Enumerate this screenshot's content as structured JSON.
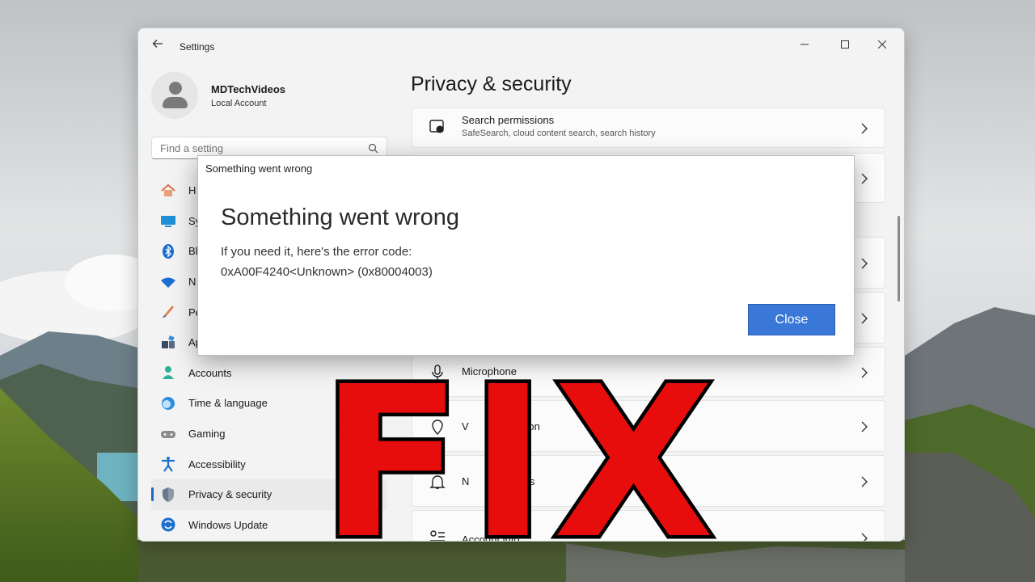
{
  "window": {
    "app_title": "Settings",
    "back_icon": "arrow-left-icon",
    "controls": {
      "minimize_icon": "minimize-icon",
      "maximize_icon": "maximize-icon",
      "close_icon": "close-icon"
    }
  },
  "profile": {
    "name": "MDTechVideos",
    "account_type": "Local Account"
  },
  "search": {
    "placeholder": "Find a setting"
  },
  "sidebar": {
    "items": [
      {
        "label": "H",
        "icon": "home-icon"
      },
      {
        "label": "Sy",
        "icon": "system-icon"
      },
      {
        "label": "Bl",
        "icon": "bluetooth-icon"
      },
      {
        "label": "N",
        "icon": "network-icon"
      },
      {
        "label": "Pe",
        "icon": "personalization-icon"
      },
      {
        "label": "Ap",
        "icon": "apps-icon"
      },
      {
        "label": "Accounts",
        "icon": "accounts-icon"
      },
      {
        "label": "Time & language",
        "icon": "time-language-icon"
      },
      {
        "label": "Gaming",
        "icon": "gaming-icon"
      },
      {
        "label": "Accessibility",
        "icon": "accessibility-icon"
      },
      {
        "label": "Privacy & security",
        "icon": "shield-icon",
        "active": true
      },
      {
        "label": "Windows Update",
        "icon": "windows-update-icon"
      }
    ]
  },
  "main": {
    "title": "Privacy & security",
    "cards": [
      {
        "title": "Search permissions",
        "subtitle": "SafeSearch, cloud content search, search history",
        "icon": "search-permissions-icon"
      },
      {
        "title": "",
        "subtitle": "",
        "icon": ""
      },
      {
        "title": "",
        "subtitle": "",
        "icon": ""
      },
      {
        "title": "",
        "subtitle": "",
        "icon": ""
      },
      {
        "title": "Microphone",
        "subtitle": "",
        "icon": "microphone-icon"
      },
      {
        "title": "V",
        "title_tail": "ation",
        "subtitle": "",
        "icon": "location-icon"
      },
      {
        "title": "N",
        "title_tail": "ons",
        "subtitle": "",
        "icon": "notifications-icon"
      },
      {
        "title": "Account info",
        "subtitle": "",
        "icon": "account-info-icon"
      }
    ]
  },
  "dialog": {
    "caption": "Something went wrong",
    "heading": "Something went wrong",
    "line1": "If you need it, here's the error code:",
    "line2": "0xA00F4240<Unknown> (0x80004003)",
    "close_label": "Close",
    "close_color": "#3a78d8"
  },
  "overlay": {
    "text": "FIX",
    "color": "#e80d0d"
  }
}
